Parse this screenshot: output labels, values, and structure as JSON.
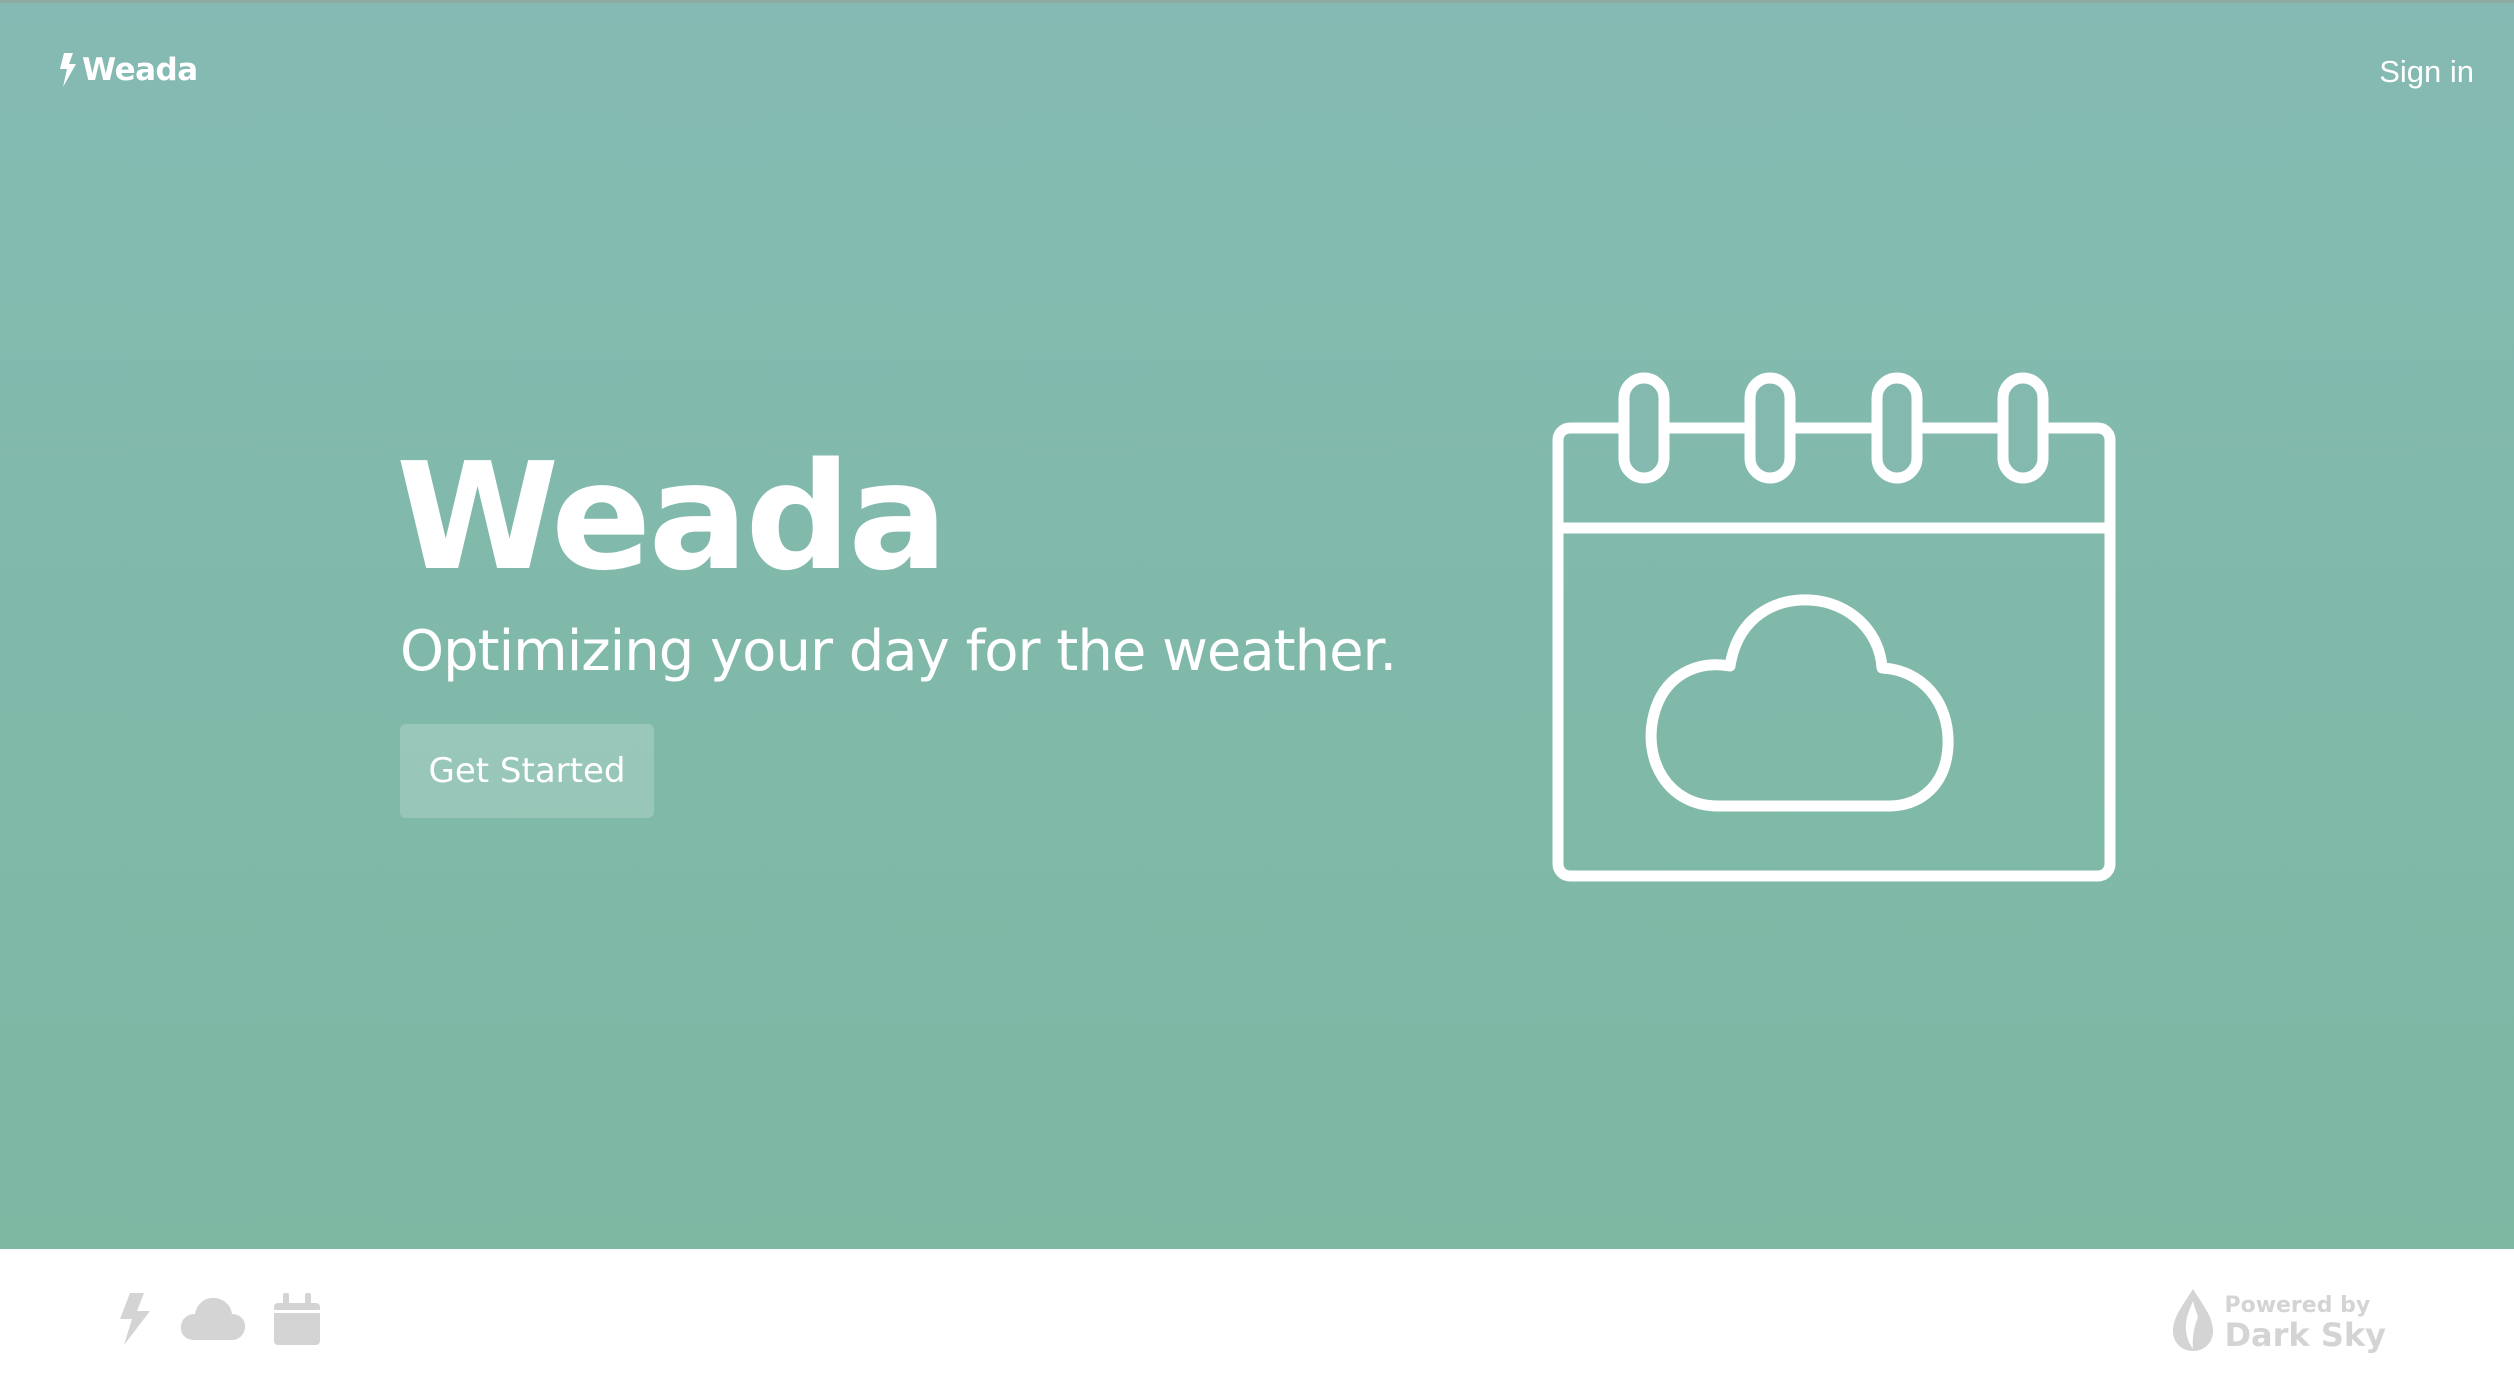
{
  "nav": {
    "brand": "Weada",
    "sign_in": "Sign in"
  },
  "hero": {
    "title": "Weada",
    "tagline": "Optimizing your day for the weather.",
    "cta_label": "Get Started"
  },
  "illustration": {
    "icon": "calendar-cloud-icon"
  },
  "footer": {
    "icons": [
      "bolt-icon",
      "cloud-icon",
      "calendar-icon"
    ],
    "powered_by": "Powered by",
    "provider": "Dark Sky"
  },
  "colors": {
    "hero_background": "#80b9aa",
    "footer_background": "#ffffff",
    "footer_icon": "#d4d4d4",
    "text": "#ffffff"
  }
}
